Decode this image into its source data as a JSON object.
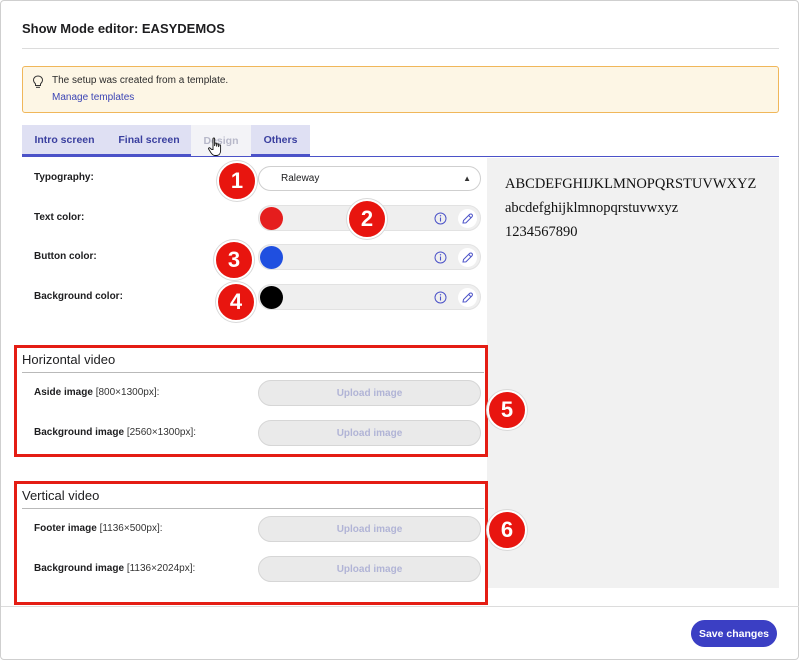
{
  "dialog": {
    "title": "Show Mode editor: EASYDEMOS"
  },
  "notice": {
    "icon": "lightbulb-icon",
    "message": "The setup was created from a template.",
    "link": "Manage templates"
  },
  "tabs": [
    {
      "label": "Intro screen",
      "active": false
    },
    {
      "label": "Final screen",
      "active": false
    },
    {
      "label": "Design",
      "active": true
    },
    {
      "label": "Others",
      "active": false
    }
  ],
  "typography": {
    "label": "Typography:",
    "value": "Raleway"
  },
  "colors": {
    "text": {
      "label": "Text color:",
      "value": "#e51d1d"
    },
    "button": {
      "label": "Button color:",
      "value": "#1f4fe0"
    },
    "background": {
      "label": "Background color:",
      "value": "#000000"
    }
  },
  "preview": {
    "uppercase": "ABCDEFGHIJKLMNOPQRSTUVWXYZ",
    "lowercase": "abcdefghijklmnopqrstuvwxyz",
    "digits": "1234567890"
  },
  "horizontal_video": {
    "title": "Horizontal video",
    "aside": {
      "label": "Aside image",
      "size": "[800×1300px]:",
      "button": "Upload image"
    },
    "background": {
      "label": "Background image",
      "size": "[2560×1300px]:",
      "button": "Upload image"
    }
  },
  "vertical_video": {
    "title": "Vertical video",
    "footer": {
      "label": "Footer image",
      "size": "[1136×500px]:",
      "button": "Upload image"
    },
    "background": {
      "label": "Background image",
      "size": "[1136×2024px]:",
      "button": "Upload image"
    }
  },
  "badges": [
    "1",
    "2",
    "3",
    "4",
    "5",
    "6"
  ],
  "footer": {
    "save": "Save changes"
  },
  "accent_colors": {
    "primary": "#3b3fc4",
    "annotation": "#e41d14",
    "notice_border": "#f0b75a"
  }
}
